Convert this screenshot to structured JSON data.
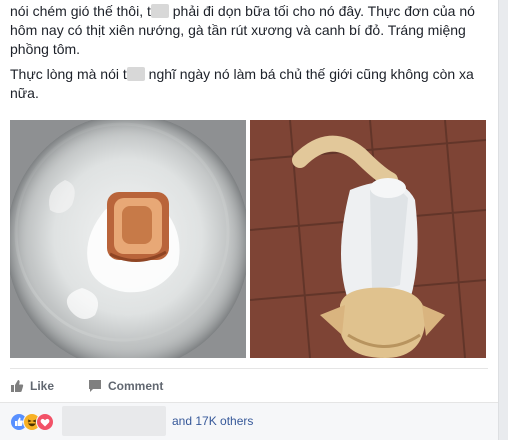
{
  "post": {
    "paragraph1_a": "nói chém gió thế thôi, t",
    "paragraph1_b": " phải đi dọn bữa tối cho nó đây. Thực đơn của nó hôm nay có thịt xiên nướng, gà tần rút xương và canh bí đỏ. Tráng miệng phồng tôm.",
    "paragraph2_a": "Thực lòng mà nói t",
    "paragraph2_b": " nghĩ ngày nó làm bá chủ thế giới cũng không còn xa nữa."
  },
  "photos": {
    "left_icon": "bowl-of-food-image",
    "right_icon": "dog-in-white-shirt-image"
  },
  "actions": {
    "like_label": "Like",
    "comment_label": "Comment"
  },
  "reactions": {
    "others_text": "and 17K others",
    "icons": [
      "like-reaction-icon",
      "haha-reaction-icon",
      "love-reaction-icon"
    ]
  },
  "colors": {
    "link": "#365899",
    "like_blue": "#5890ff",
    "haha_yellow": "#f7b125",
    "love_red": "#f25268"
  }
}
